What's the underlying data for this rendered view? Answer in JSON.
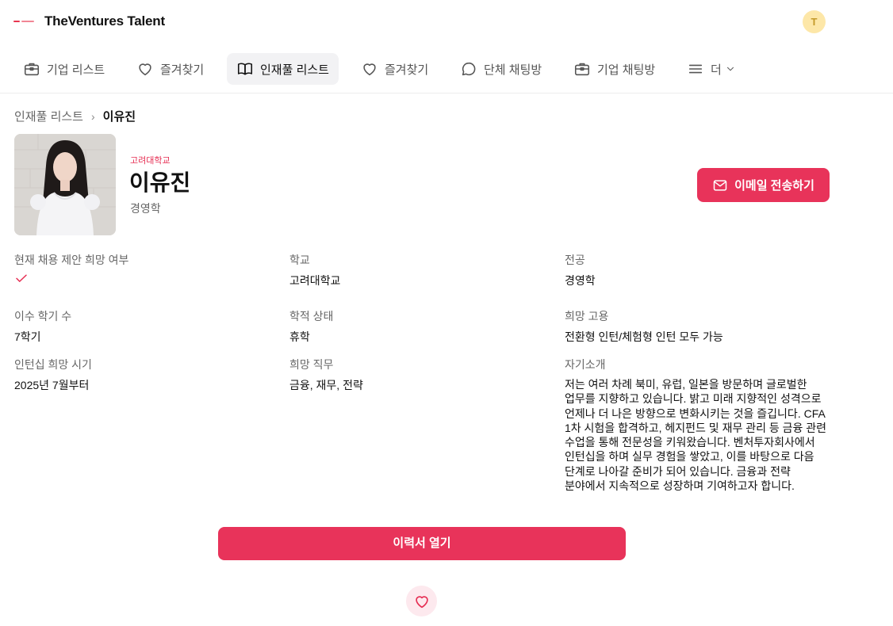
{
  "app": {
    "title": "TheVentures Talent",
    "avatar_initial": "T"
  },
  "nav": {
    "items": [
      {
        "label": "기업 리스트",
        "icon": "briefcase-icon"
      },
      {
        "label": "즐겨찾기",
        "icon": "heart-icon"
      },
      {
        "label": "인재풀 리스트",
        "icon": "book-icon",
        "active": true
      },
      {
        "label": "즐겨찾기",
        "icon": "heart-icon"
      },
      {
        "label": "단체 채팅방",
        "icon": "chat-bubble-icon"
      },
      {
        "label": "기업 채팅방",
        "icon": "briefcase-icon"
      },
      {
        "label": "더",
        "icon": "menu-icon"
      }
    ]
  },
  "breadcrumb": {
    "parent": "인재풀 리스트",
    "current": "이유진"
  },
  "profile": {
    "school_tag": "고려대학교",
    "name": "이유진",
    "major": "경영학",
    "email_button": "이메일 전송하기"
  },
  "fields": {
    "offer_wanted": {
      "label": "현재 채용 제안 희망 여부",
      "value": true
    },
    "school": {
      "label": "학교",
      "value": "고려대학교"
    },
    "major": {
      "label": "전공",
      "value": "경영학"
    },
    "semesters": {
      "label": "이수 학기 수",
      "value": "7학기"
    },
    "status": {
      "label": "학적 상태",
      "value": "휴학"
    },
    "employment": {
      "label": "희망 고용",
      "value": "전환형 인턴/체험형 인턴 모두 가능"
    },
    "intern_period": {
      "label": "인턴십 희망 시기",
      "value": "2025년 7월부터"
    },
    "job": {
      "label": "희망 직무",
      "value": "금융, 재무, 전략"
    },
    "intro": {
      "label": "자기소개",
      "value": "저는 여러 차례 북미, 유럽, 일본을 방문하며 글로벌한 업무를 지향하고 있습니다. 밝고 미래 지향적인 성격으로 언제나 더 나은 방향으로 변화시키는 것을 즐깁니다. CFA 1차 시험을 합격하고, 헤지펀드 및 재무 관리 등 금융 관련 수업을 통해 전문성을 키워왔습니다. 벤처투자회사에서 인턴십을 하며 실무 경험을 쌓았고, 이를 바탕으로 다음 단계로 나아갈 준비가 되어 있습니다. 금융과 전략 분야에서 지속적으로 성장하며 기여하고자 합니다."
    }
  },
  "actions": {
    "resume_button": "이력서 열기"
  },
  "colors": {
    "accent": "#e8335a",
    "accent_text": "#e62d52",
    "avatar_bg": "#fde7a8"
  }
}
